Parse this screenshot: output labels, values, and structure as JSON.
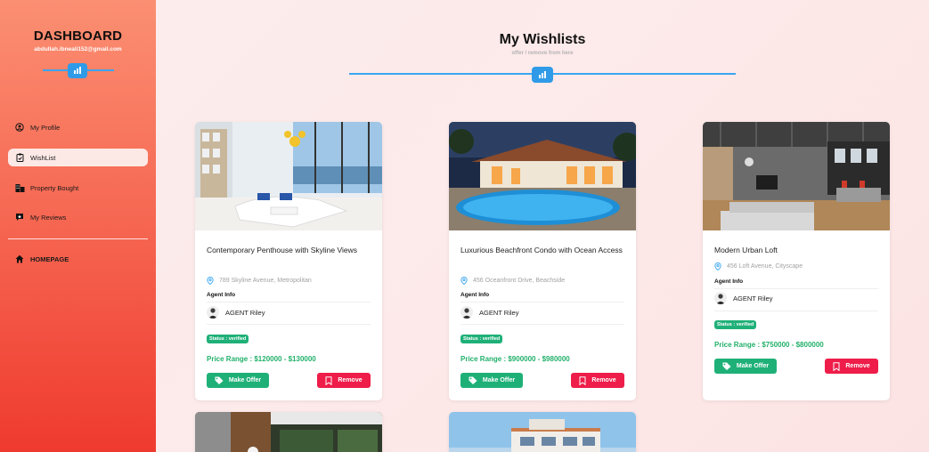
{
  "sidebar": {
    "title": "DASHBOARD",
    "email": "abdullah.ibneali152@gmail.com",
    "items": [
      {
        "label": "My Profile",
        "icon": "user-circle-icon"
      },
      {
        "label": "WishList",
        "icon": "clipboard-icon"
      },
      {
        "label": "Property Bought",
        "icon": "buildings-icon"
      },
      {
        "label": "My Reviews",
        "icon": "review-icon"
      }
    ],
    "home_label": "HOMEPAGE"
  },
  "header": {
    "title": "My Wishlists",
    "subtitle": "offer / remove from here"
  },
  "cards": [
    {
      "name": "Contemporary Penthouse with Skyline Views",
      "address": "789 Skyline Avenue, Metropolitan",
      "agent_info_label": "Agent Info",
      "agent": "AGENT Riley",
      "status": "Status : verified",
      "price": "Price Range : $120000 - $130000",
      "offer_label": "Make Offer",
      "remove_label": "Remove"
    },
    {
      "name": "Luxurious Beachfront Condo with Ocean Access",
      "address": "456 Oceanfront Drive, Beachside",
      "agent_info_label": "Agent Info",
      "agent": "AGENT Riley",
      "status": "Status : verified",
      "price": "Price Range : $900000 - $980000",
      "offer_label": "Make Offer",
      "remove_label": "Remove"
    },
    {
      "name": "Modern Urban Loft",
      "address": "456 Loft Avenue, Cityscape",
      "agent_info_label": "Agent Info",
      "agent": "AGENT Riley",
      "status": "Status : verified",
      "price": "Price Range : $750000 - $800000",
      "offer_label": "Make Offer",
      "remove_label": "Remove"
    }
  ],
  "colors": {
    "accent_blue": "#2f9be8",
    "offer_green": "#1fb078",
    "remove_red": "#ee1d49",
    "price_green": "#22b06a"
  }
}
